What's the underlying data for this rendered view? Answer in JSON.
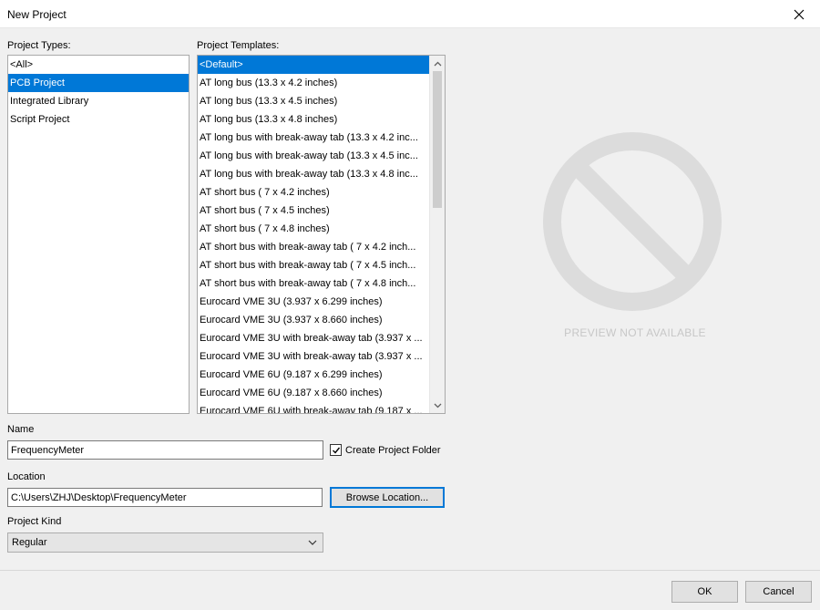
{
  "window": {
    "title": "New Project"
  },
  "project_types": {
    "label": "Project Types:",
    "items": [
      "<All>",
      "PCB Project",
      "Integrated Library",
      "Script Project"
    ],
    "selected": "PCB Project"
  },
  "project_templates": {
    "label": "Project Templates:",
    "items": [
      "<Default>",
      "AT long bus (13.3 x 4.2 inches)",
      "AT long bus (13.3 x 4.5 inches)",
      "AT long bus (13.3 x 4.8 inches)",
      "AT long bus with break-away tab (13.3 x 4.2 inc...",
      "AT long bus with break-away tab (13.3 x 4.5 inc...",
      "AT long bus with break-away tab (13.3 x 4.8 inc...",
      "AT short bus ( 7 x 4.2 inches)",
      "AT short bus ( 7 x 4.5 inches)",
      "AT short bus ( 7 x 4.8 inches)",
      "AT short bus with break-away tab ( 7 x 4.2 inch...",
      "AT short bus with break-away tab ( 7 x 4.5 inch...",
      "AT short bus with break-away tab ( 7 x 4.8 inch...",
      "Eurocard VME 3U (3.937 x 6.299 inches)",
      "Eurocard VME 3U (3.937 x 8.660 inches)",
      "Eurocard VME 3U with break-away tab (3.937 x ...",
      "Eurocard VME 3U with break-away tab (3.937 x ...",
      "Eurocard VME 6U (9.187 x 6.299 inches)",
      "Eurocard VME 6U (9.187 x 8.660 inches)",
      "Eurocard VME 6U with break-away tab (9.187 x ..."
    ],
    "selected": "<Default>"
  },
  "preview": {
    "text": "PREVIEW NOT AVAILABLE",
    "icon": "no-preview-icon"
  },
  "name": {
    "label": "Name",
    "value": "FrequencyMeter"
  },
  "create_folder": {
    "label": "Create Project Folder",
    "checked": true
  },
  "location": {
    "label": "Location",
    "value": "C:\\Users\\ZHJ\\Desktop\\FrequencyMeter",
    "browse_label": "Browse Location..."
  },
  "project_kind": {
    "label": "Project Kind",
    "value": "Regular"
  },
  "footer": {
    "ok_label": "OK",
    "cancel_label": "Cancel"
  },
  "colors": {
    "selection": "#0078d7",
    "preview_gray": "#dcdcdc"
  }
}
